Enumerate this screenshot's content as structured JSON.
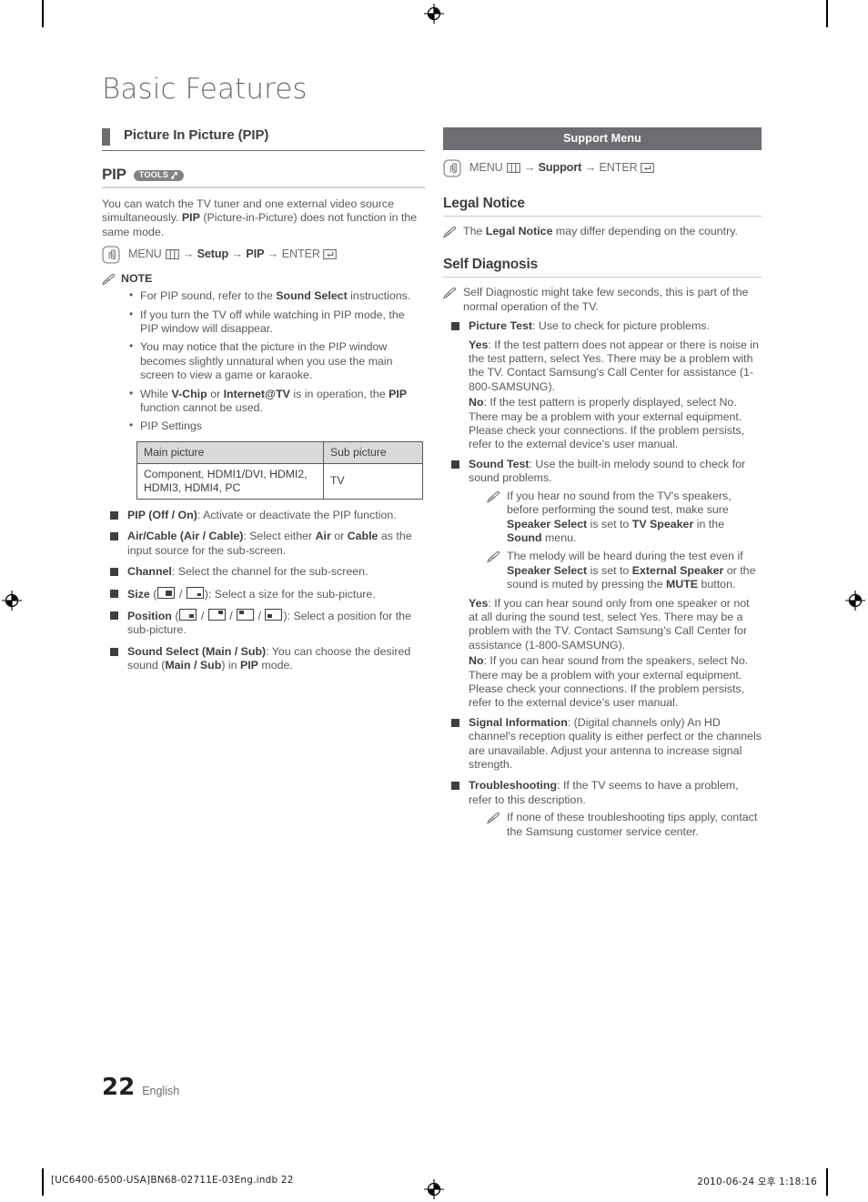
{
  "document": {
    "title": "Basic Features",
    "page_number": "22",
    "language": "English",
    "colophon": "[UC6400-6500-USA]BN68-02711E-03Eng.indb   22",
    "timestamp": "2010-06-24   오후 1:18:16"
  },
  "left_column": {
    "section_heading": "Picture In Picture (PIP)",
    "sub_heading": {
      "label": "PIP",
      "badge": "TOOLS",
      "badge_icon": "tools-arrow-icon"
    },
    "intro_parts": {
      "a": "You can watch the TV tuner and one external video source simultaneously. ",
      "b": "PIP",
      "c": " (Picture-in-Picture) does not function in the same mode."
    },
    "menu_path": {
      "icon": "hand-press-icon",
      "menu": "MENU",
      "menu_icon": "menu-grid-icon",
      "arrow1": "→",
      "step2": "Setup",
      "arrow2": "→",
      "step3": "PIP",
      "arrow3": "→",
      "enter": "ENTER",
      "enter_icon": "enter-key-icon"
    },
    "note": {
      "icon": "pencil-note-icon",
      "label": "NOTE",
      "items": [
        {
          "a": "For PIP sound, refer to the ",
          "b": "Sound Select",
          "c": " instructions."
        },
        {
          "a": "If you turn the TV off while watching in PIP mode, the PIP window will disappear.",
          "b": "",
          "c": ""
        },
        {
          "a": "You may notice that the picture in the PIP window becomes slightly unnatural when you use the main screen to view a game or karaoke.",
          "b": "",
          "c": ""
        },
        {
          "a": "While ",
          "b": "V-Chip",
          "c": " or ",
          "d": "Internet@TV",
          "e": " is in operation, the ",
          "f": "PIP",
          "g": " function cannot be used."
        },
        {
          "a": "PIP Settings",
          "b": "",
          "c": ""
        }
      ]
    },
    "table": {
      "headers": [
        "Main picture",
        "Sub picture"
      ],
      "rows": [
        [
          "Component, HDMI1/DVI, HDMI2, HDMI3, HDMI4, PC",
          "TV"
        ]
      ]
    },
    "settings": [
      {
        "key": "PIP (Off / On)",
        "rest": ": Activate or deactivate the PIP function."
      },
      {
        "key": "Air/Cable (Air / Cable)",
        "mid1": ": Select either ",
        "b1": "Air",
        "mid2": " or ",
        "b2": "Cable",
        "rest": " as the input source for the sub-screen."
      },
      {
        "key": "Channel",
        "rest": ": Select the channel for the sub-screen."
      },
      {
        "key": "Size",
        "icons": [
          "pip-size-large-icon",
          "pip-size-small-icon"
        ],
        "rest": ": Select a size for the sub-picture."
      },
      {
        "key": "Position",
        "icons": [
          "pip-pos-bottom-right-icon",
          "pip-pos-top-right-icon",
          "pip-pos-top-left-icon",
          "pip-pos-bottom-left-icon"
        ],
        "rest": ": Select a position for the sub-picture."
      },
      {
        "key": "Sound Select (Main / Sub)",
        "mid1": ": You can choose the desired sound (",
        "b1": "Main / Sub",
        "mid2": ") in ",
        "b2": "PIP",
        "rest": " mode."
      }
    ]
  },
  "right_column": {
    "menu_bar": "Support Menu",
    "menu_path": {
      "icon": "hand-press-icon",
      "menu": "MENU",
      "menu_icon": "menu-grid-icon",
      "arrow1": "→",
      "step2": "Support",
      "arrow2": "→",
      "enter": "ENTER",
      "enter_icon": "enter-key-icon"
    },
    "legal_notice": {
      "heading": "Legal Notice",
      "note": {
        "icon": "pencil-note-icon",
        "a": "The ",
        "b": "Legal Notice",
        "c": " may differ depending on the country."
      }
    },
    "self_diagnosis": {
      "heading": "Self Diagnosis",
      "intro_note": {
        "icon": "pencil-note-icon",
        "text": "Self Diagnostic might take few seconds, this is part of the normal operation of the TV."
      },
      "items": [
        {
          "key": "Picture Test",
          "rest": ": Use to check for picture problems.",
          "paras": [
            {
              "label": "Yes",
              "text": ": If the test pattern does not appear or there is noise in the test pattern, select Yes. There may be a problem with the TV. Contact Samsung's Call Center for assistance (1-800-SAMSUNG)."
            },
            {
              "label": "No",
              "text": ": If the test pattern is properly displayed, select No. There may be a problem with your external equipment. Please check your connections. If the problem persists, refer to the external device's user manual."
            }
          ]
        },
        {
          "key": "Sound Test",
          "rest": ": Use the built-in melody sound to check for sound problems.",
          "subnotes": [
            {
              "a": "If you hear no sound from the TV's speakers, before performing the sound test, make sure ",
              "b": "Speaker Select",
              "c": " is set to ",
              "d": "TV Speaker",
              "e": " in the ",
              "f": "Sound",
              "g": " menu."
            },
            {
              "a": "The melody will be heard during the test even if ",
              "b": "Speaker Select",
              "c": " is set to ",
              "d": "External Speaker",
              "e": " or the sound is muted by pressing the ",
              "f": "MUTE",
              "g": " button."
            }
          ],
          "paras": [
            {
              "label": "Yes",
              "text": ": If you can hear sound only from one speaker or not at all during the sound test, select Yes. There may be a problem with the TV. Contact Samsung's Call Center for assistance (1-800-SAMSUNG)."
            },
            {
              "label": "No",
              "text": ": If you can hear sound from the speakers, select No. There may be a problem with your external equipment. Please check your connections. If the problem persists, refer to the external device's user manual."
            }
          ]
        },
        {
          "key": "Signal Information",
          "rest": ": (Digital channels only) An HD channel's reception quality is either perfect or the channels are unavailable. Adjust your antenna to increase signal strength."
        },
        {
          "key": "Troubleshooting",
          "rest": ": If the TV seems to have a problem, refer to this description.",
          "subnotes_plain": [
            "If none of these troubleshooting tips apply, contact the Samsung customer service center."
          ]
        }
      ]
    }
  },
  "colors": {
    "body_text": "#58595b",
    "bold_text": "#3f3f41",
    "bar_gray": "#6d6e71",
    "table_header": "#d9dadb",
    "rule_light": "#d6d7d8"
  }
}
